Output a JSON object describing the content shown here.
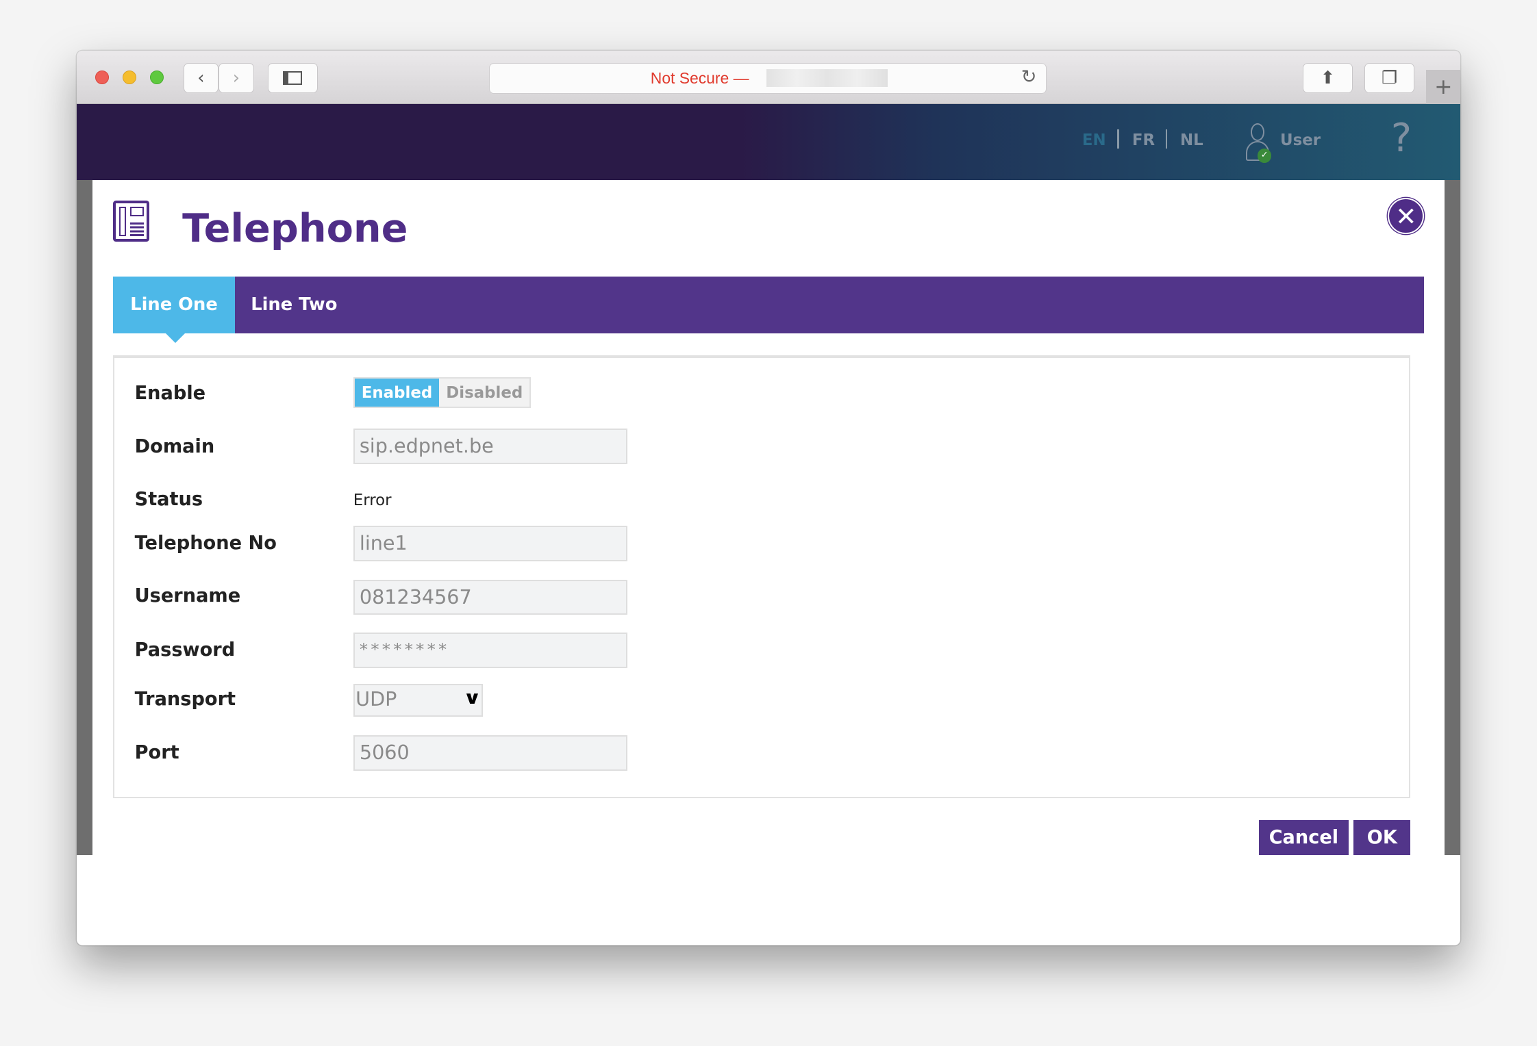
{
  "browser": {
    "url_text": "Not Secure —",
    "icons": [
      "back-icon",
      "forward-icon",
      "sidebar-icon",
      "reload-icon",
      "share-icon",
      "tabs-icon",
      "new-tab-icon"
    ]
  },
  "header": {
    "languages": [
      "EN",
      "FR",
      "NL"
    ],
    "active_language": "EN",
    "user_label": "User"
  },
  "modal": {
    "title": "Telephone",
    "tabs": [
      {
        "label": "Line One",
        "active": true
      },
      {
        "label": "Line Two",
        "active": false
      }
    ],
    "form": {
      "enable": {
        "label": "Enable",
        "options": [
          "Enabled",
          "Disabled"
        ],
        "selected": "Enabled"
      },
      "domain": {
        "label": "Domain",
        "value": "sip.edpnet.be"
      },
      "status": {
        "label": "Status",
        "value": "Error"
      },
      "telephone_no": {
        "label": "Telephone No",
        "value": "line1"
      },
      "username": {
        "label": "Username",
        "value": "081234567"
      },
      "password": {
        "label": "Password",
        "value": "********"
      },
      "transport": {
        "label": "Transport",
        "value": "UDP"
      },
      "port": {
        "label": "Port",
        "value": "5060"
      }
    },
    "buttons": {
      "cancel": "Cancel",
      "ok": "OK"
    }
  },
  "colors": {
    "brand_purple": "#52358a",
    "accent_blue": "#4db8e8",
    "warning_red": "#e0392c"
  }
}
